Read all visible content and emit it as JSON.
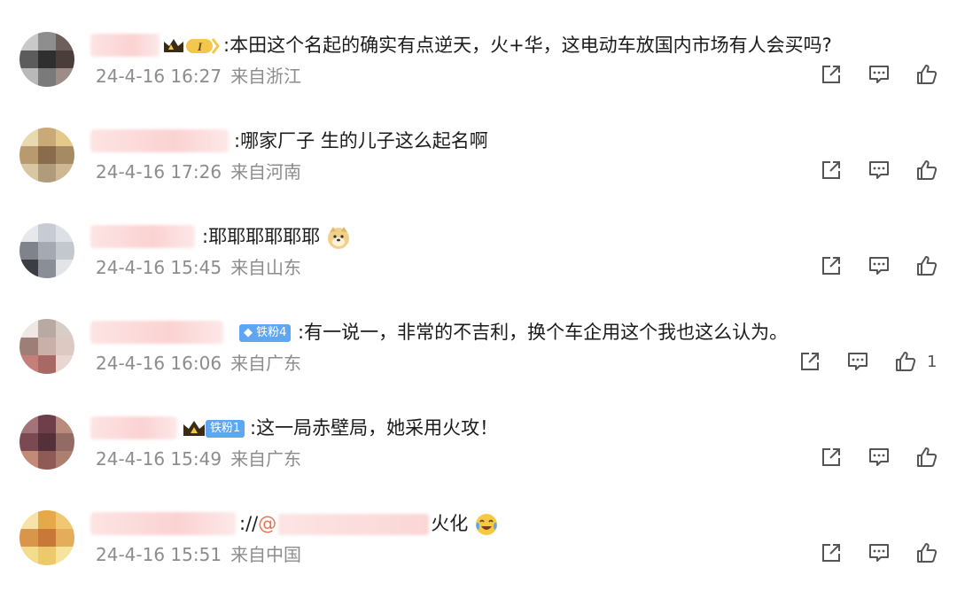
{
  "comments": [
    {
      "text": ":本田这个名起的确实有点逆天，火+华，这电动车放国内市场有人会买吗?",
      "time": "24-4-16 16:27",
      "location": "来自浙江",
      "like_count": ""
    },
    {
      "text": ":哪家厂子  生的儿子这么起名啊",
      "time": "24-4-16 17:26",
      "location": "来自河南",
      "like_count": ""
    },
    {
      "text": ":耶耶耶耶耶耶",
      "time": "24-4-16 15:45",
      "location": "来自山东",
      "like_count": ""
    },
    {
      "text": ":有一说一，非常的不吉利，换个车企用这个我也这么认为。",
      "time": "24-4-16 16:06",
      "location": "来自广东",
      "like_count": "1",
      "badge": "铁粉4"
    },
    {
      "text": ":这一局赤壁局，她采用火攻！",
      "time": "24-4-16 15:49",
      "location": "来自广东",
      "like_count": "",
      "badge": "铁粉1"
    },
    {
      "text_prefix": "://",
      "mention": "@",
      "text": "火化",
      "time": "24-4-16 15:51",
      "location": "来自中国",
      "like_count": ""
    }
  ],
  "level_badge": "I",
  "icons": [
    "repost-icon",
    "comment-icon",
    "like-icon"
  ],
  "colors": {
    "meta": "#8c8c8c",
    "badge": "#5ea6f2",
    "mention": "#eb7350"
  }
}
